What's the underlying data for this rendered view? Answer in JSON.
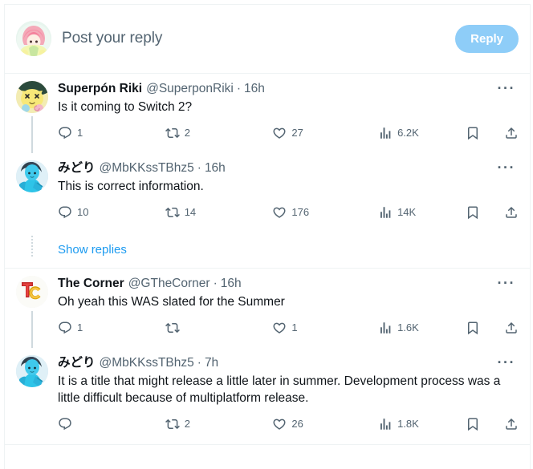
{
  "compose": {
    "placeholder": "Post your reply",
    "reply_button_label": "Reply",
    "avatar_name": "anime-girl-pink-hair-avatar",
    "accent_color": "#1d9bf0",
    "reply_button_color": "#8ecdf8"
  },
  "link_color": "#1d9bf0",
  "text_color": "#0f1419",
  "muted_color": "#536471",
  "divider_color": "#eff3f4",
  "show_replies_label": "Show replies",
  "icons": {
    "reply": "comment-icon",
    "retweet": "retweet-icon",
    "like": "heart-icon",
    "views": "views-bar-chart-icon",
    "bookmark": "bookmark-icon",
    "share": "share-icon",
    "more": "more-options-icon"
  },
  "replies": [
    {
      "display_name": "Superpón Riki",
      "handle": "@SuperponRiki",
      "separator": "·",
      "time": "16h",
      "text": "Is it coming to Switch 2?",
      "avatar_name": "yellow-cat-avatar",
      "more_label": "···",
      "metrics": {
        "replies": "1",
        "retweets": "2",
        "likes": "27",
        "views": "6.2K"
      }
    },
    {
      "display_name": "みどり",
      "handle": "@MbKKssTBhz5",
      "separator": "·",
      "time": "16h",
      "text": "This is correct information.",
      "avatar_name": "blue-character-avatar",
      "more_label": "···",
      "metrics": {
        "replies": "10",
        "retweets": "14",
        "likes": "176",
        "views": "14K"
      }
    },
    {
      "display_name": "The Corner",
      "handle": "@GTheCorner",
      "separator": "·",
      "time": "16h",
      "text": "Oh yeah this WAS slated for the Summer",
      "avatar_name": "tc-logo-avatar",
      "more_label": "···",
      "metrics": {
        "replies": "1",
        "retweets": "",
        "likes": "1",
        "views": "1.6K"
      }
    },
    {
      "display_name": "みどり",
      "handle": "@MbKKssTBhz5",
      "separator": "·",
      "time": "7h",
      "text": "It is a title that might release a little later in summer. Development process was a little difficult because of multiplatform release.",
      "avatar_name": "blue-character-avatar",
      "more_label": "···",
      "metrics": {
        "replies": "",
        "retweets": "2",
        "likes": "26",
        "views": "1.8K"
      }
    }
  ]
}
